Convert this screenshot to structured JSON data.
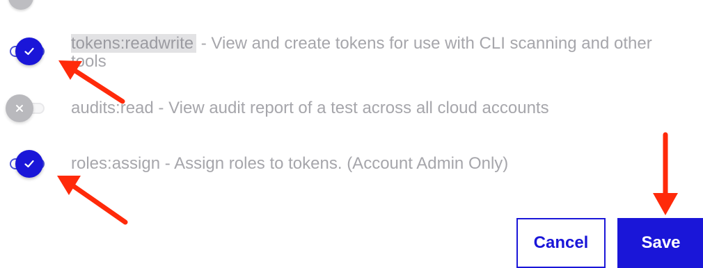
{
  "permissions": [
    {
      "scope": "tokens:readwrite",
      "description": " - View and create tokens for use with CLI scanning and other tools",
      "enabled": true
    },
    {
      "scope": "audits:read",
      "description": " - View audit report of a test across all cloud accounts",
      "enabled": false
    },
    {
      "scope": "roles:assign",
      "description": " - Assign roles to tokens. (Account Admin Only)",
      "enabled": true
    }
  ],
  "actions": {
    "cancel_label": "Cancel",
    "save_label": "Save"
  },
  "icons": {
    "enabled_knob": "checkmark-icon",
    "disabled_knob": "x-icon"
  },
  "colors": {
    "accent": "#1a16d8",
    "toggle_off": "#b9b9bd",
    "label_text": "#a6a6ab",
    "annotation_arrow": "#ff2a0a"
  }
}
